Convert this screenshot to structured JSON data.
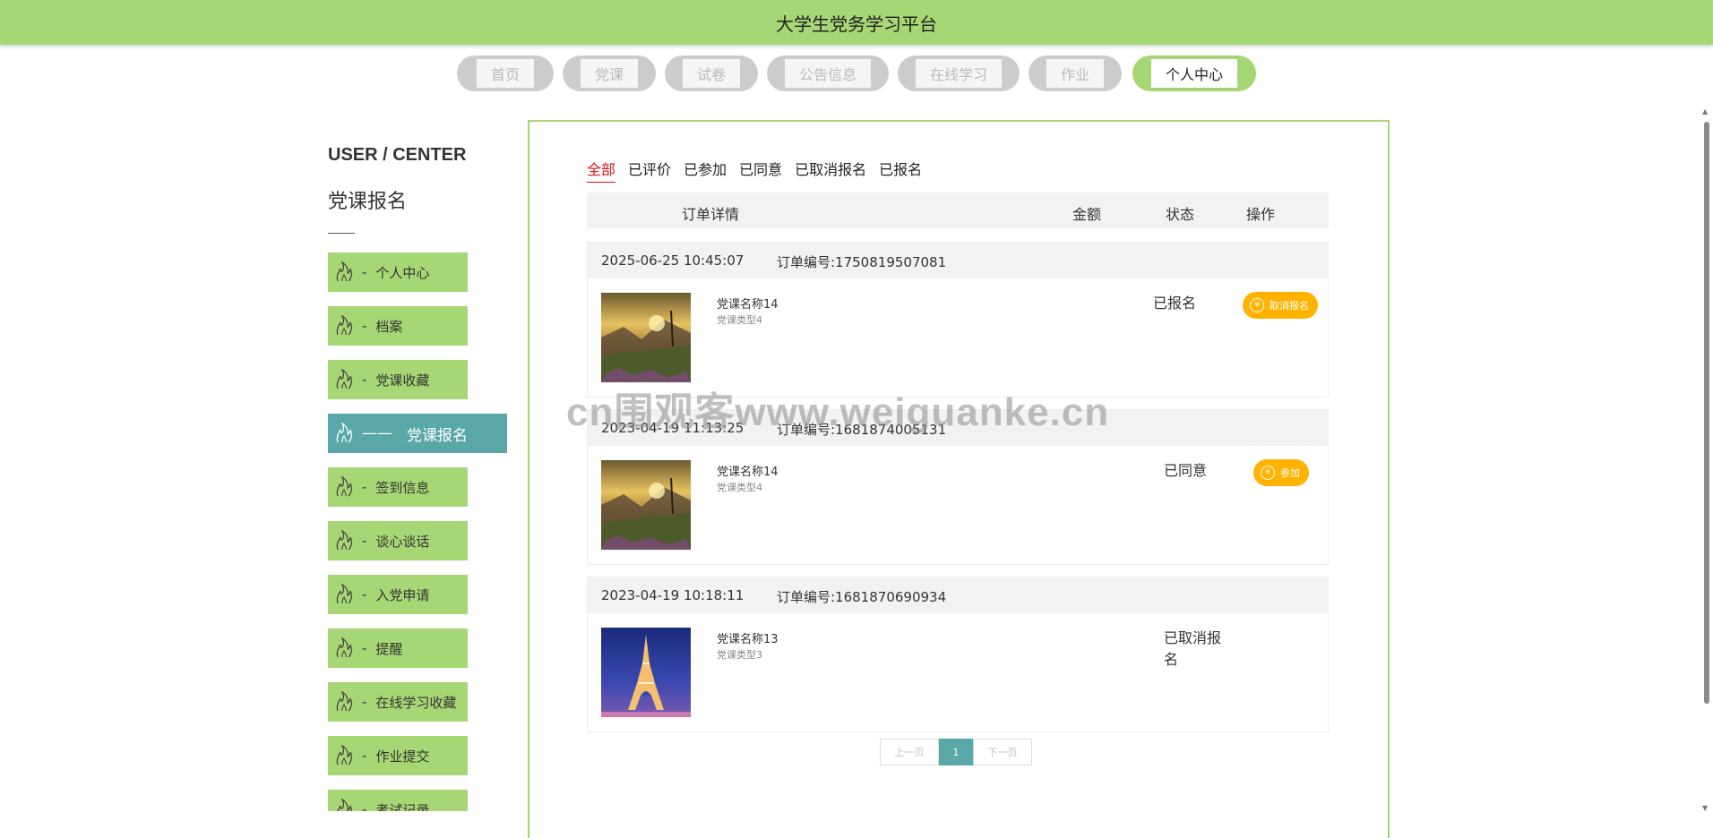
{
  "header": {
    "title": "大学生党务学习平台"
  },
  "nav": {
    "items": [
      {
        "label": "首页"
      },
      {
        "label": "党课"
      },
      {
        "label": "试卷"
      },
      {
        "label": "公告信息"
      },
      {
        "label": "在线学习"
      },
      {
        "label": "作业"
      },
      {
        "label": "个人中心",
        "active": true
      }
    ]
  },
  "sidebar": {
    "heading": "USER / CENTER",
    "subtitle": "党课报名",
    "items": [
      {
        "label": "个人中心"
      },
      {
        "label": "档案"
      },
      {
        "label": "党课收藏"
      },
      {
        "label": "党课报名",
        "active": true
      },
      {
        "label": "签到信息"
      },
      {
        "label": "谈心谈话"
      },
      {
        "label": "入党申请"
      },
      {
        "label": "提醒"
      },
      {
        "label": "在线学习收藏"
      },
      {
        "label": "作业提交"
      },
      {
        "label": "考试记录"
      }
    ]
  },
  "tabs": [
    {
      "label": "全部",
      "active": true
    },
    {
      "label": "已评价"
    },
    {
      "label": "已参加"
    },
    {
      "label": "已同意"
    },
    {
      "label": "已取消报名"
    },
    {
      "label": "已报名"
    }
  ],
  "table": {
    "col_detail": "订单详情",
    "col_amount": "金额",
    "col_status": "状态",
    "col_action": "操作"
  },
  "orders": [
    {
      "time": "2025-06-25 10:45:07",
      "order_no": "订单编号:1750819507081",
      "course_name": "党课名称14",
      "course_type": "党课类型4",
      "status": "已报名",
      "action": "取消报名",
      "action_icon": "yen-coin-icon",
      "image": "mountain-sunset"
    },
    {
      "time": "2023-04-19 11:13:25",
      "order_no": "订单编号:1681874005131",
      "course_name": "党课名称14",
      "course_type": "党课类型4",
      "status": "已同意",
      "action": "参加",
      "action_icon": "yen-coin-icon",
      "image": "mountain-sunset"
    },
    {
      "time": "2023-04-19 10:18:11",
      "order_no": "订单编号:1681870690934",
      "course_name": "党课名称13",
      "course_type": "党课类型3",
      "status_line1": "已取消报",
      "status_line2": "名",
      "image": "eiffel-tower-night"
    }
  ],
  "pager": {
    "prev": "上一页",
    "current": "1",
    "next": "下一页"
  },
  "watermark": "cn围观客www.weiguanke.cn",
  "colors": {
    "accent_green": "#a6d774",
    "teal": "#59a8a7",
    "orange": "#ffb300",
    "active_tab_red": "#e0121b"
  }
}
